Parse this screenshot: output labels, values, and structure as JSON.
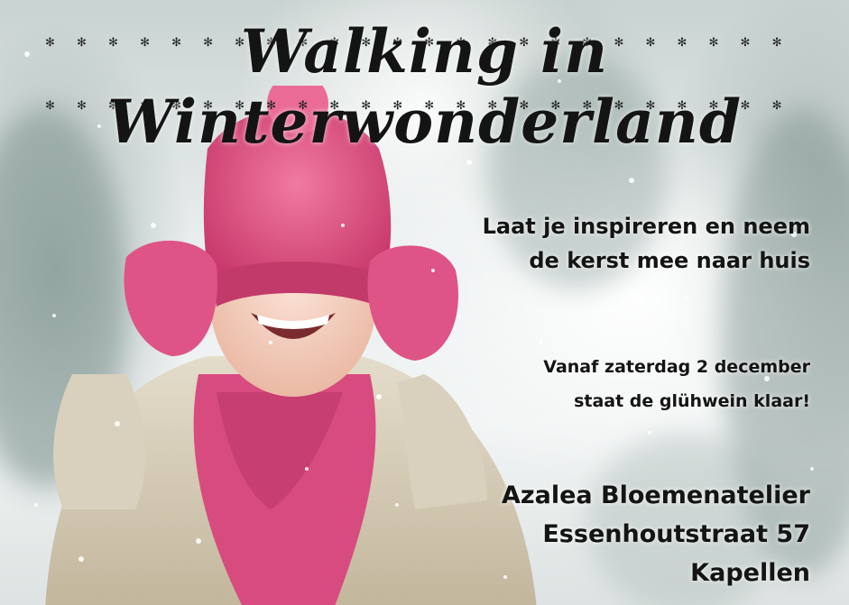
{
  "title": "Walking in Winterwonderland",
  "tagline": [
    "Laat je inspireren en neem",
    "de kerst mee naar huis"
  ],
  "dateinfo": [
    "Vanaf zaterdag 2 december",
    "staat de glühwein klaar!"
  ],
  "address": [
    "Azalea Bloemenatelier",
    "Essenhoutstraat 57",
    "Kapellen"
  ],
  "colors": {
    "hat": "#d94a7c",
    "sweater": "#d6cdb8",
    "text": "#141414",
    "background": "#e9eeee"
  },
  "icons": [
    "snowflake-icon",
    "child-photo"
  ]
}
